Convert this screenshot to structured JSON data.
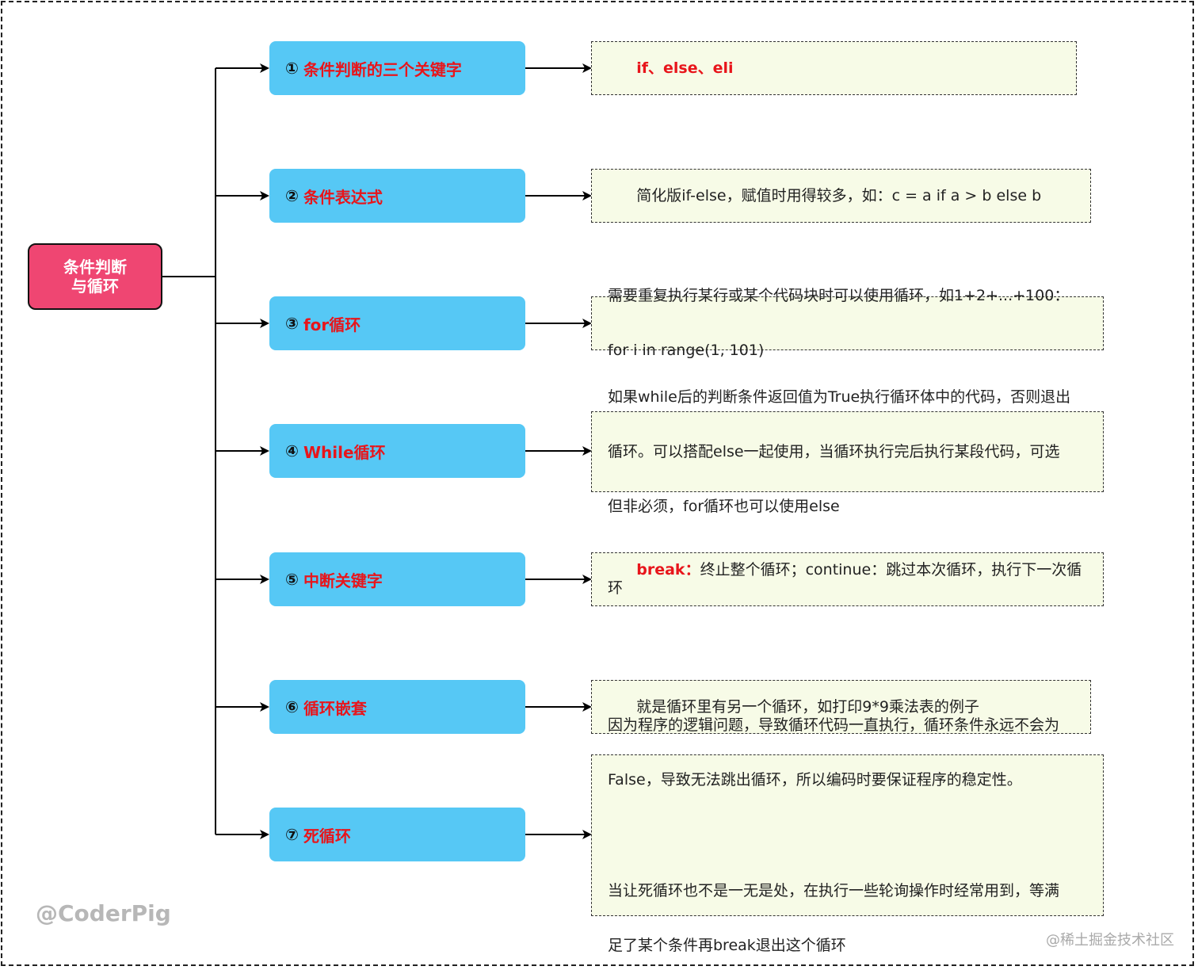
{
  "root": {
    "line1": "条件判断",
    "line2": "与循环"
  },
  "topics": [
    {
      "num": "①",
      "label": "条件判断的三个关键字"
    },
    {
      "num": "②",
      "label": "条件表达式"
    },
    {
      "num": "③",
      "label": "for循环"
    },
    {
      "num": "④",
      "label": "While循环"
    },
    {
      "num": "⑤",
      "label": "中断关键字"
    },
    {
      "num": "⑥",
      "label": "循环嵌套"
    },
    {
      "num": "⑦",
      "label": "死循环"
    }
  ],
  "notes": {
    "n1": "if、else、eli",
    "n2": "简化版if-else，赋值时用得较多，如：c = a if a > b else b",
    "n3_line1": "需要重复执行某行或某个代码块时可以使用循环，如1+2+...+100：",
    "n3_line2": "for i in range(1, 101)",
    "n4_line1": "如果while后的判断条件返回值为True执行循环体中的代码，否则退出",
    "n4_line2": "循环。可以搭配else一起使用，当循环执行完后执行某段代码，可选",
    "n4_line3": "但非必须，for循环也可以使用else",
    "n5_keyword": "break",
    "n5_sep": "：",
    "n5_rest": "终止整个循环；continue：跳过本次循环，执行下一次循环",
    "n6": "就是循环里有另一个循环，如打印9*9乘法表的例子",
    "n7_line1": "因为程序的逻辑问题，导致循环代码一直执行，循环条件永远不会为",
    "n7_line2": "False，导致无法跳出循环，所以编码时要保证程序的稳定性。",
    "n7_line3": "当让死循环也不是一无是处，在执行一些轮询操作时经常用到，等满",
    "n7_line4": "足了某个条件再break退出这个循环"
  },
  "watermarks": {
    "author": "@CoderPig",
    "site": "@稀土掘金技术社区"
  }
}
